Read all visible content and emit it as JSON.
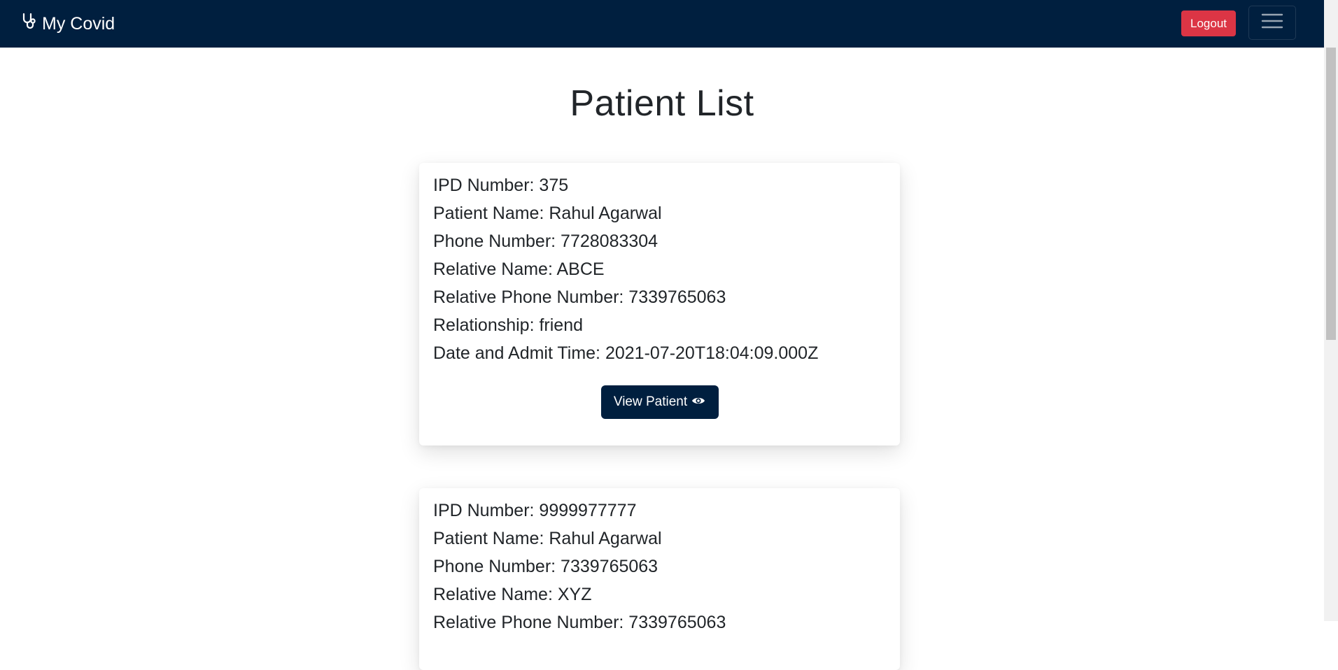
{
  "navbar": {
    "brand": "My Covid",
    "brand_icon": "stethoscope-icon",
    "logout_label": "Logout",
    "menu_icon": "hamburger-menu-icon"
  },
  "page": {
    "title": "Patient List"
  },
  "patients": [
    {
      "ipd": "IPD Number: 375",
      "name": "Patient Name: Rahul Agarwal",
      "phone": "Phone Number: 7728083304",
      "relative_name": "Relative Name: ABCE",
      "relative_phone": "Relative Phone Number: 7339765063",
      "relationship": "Relationship: friend",
      "admit_time": "Date and Admit Time: 2021-07-20T18:04:09.000Z",
      "view_label": "View Patient"
    },
    {
      "ipd": "IPD Number: 9999977777",
      "name": "Patient Name: Rahul Agarwal",
      "phone": "Phone Number: 7339765063",
      "relative_name": "Relative Name: XYZ",
      "relative_phone": "Relative Phone Number: 7339765063"
    }
  ],
  "colors": {
    "navbar_bg": "#001f3f",
    "logout_bg": "#dc3545",
    "button_bg": "#001f3f"
  }
}
